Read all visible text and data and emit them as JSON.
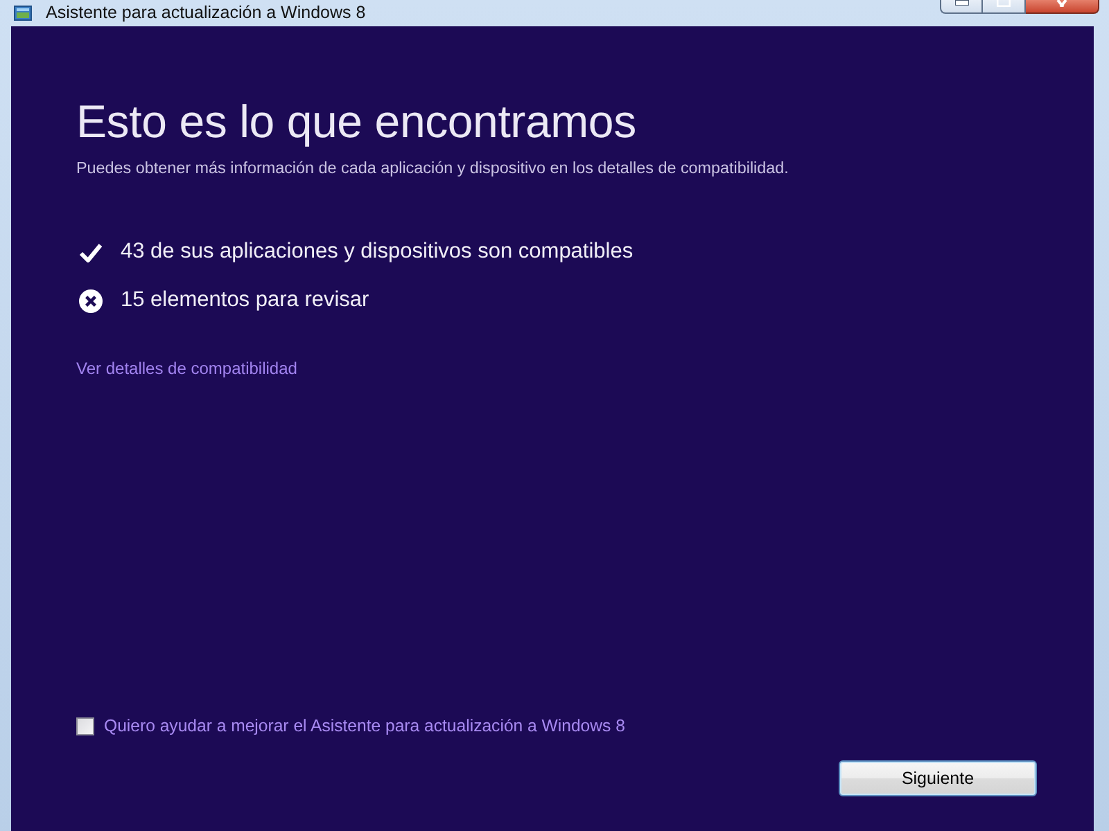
{
  "window": {
    "title": "Asistente para actualización a Windows 8"
  },
  "heading": "Esto es lo que encontramos",
  "subtitle": "Puedes obtener más información de cada aplicación y dispositivo en los detalles de compatibilidad.",
  "results": [
    {
      "kind": "compatible",
      "text": "43 de sus aplicaciones y dispositivos son compatibles"
    },
    {
      "kind": "review",
      "text": "15 elementos para revisar"
    }
  ],
  "details_link": "Ver detalles de compatibilidad",
  "feedback_checkbox": {
    "label": "Quiero ayudar a mejorar el Asistente para actualización a Windows 8",
    "checked": false
  },
  "buttons": [
    {
      "label": "Siguiente"
    }
  ]
}
